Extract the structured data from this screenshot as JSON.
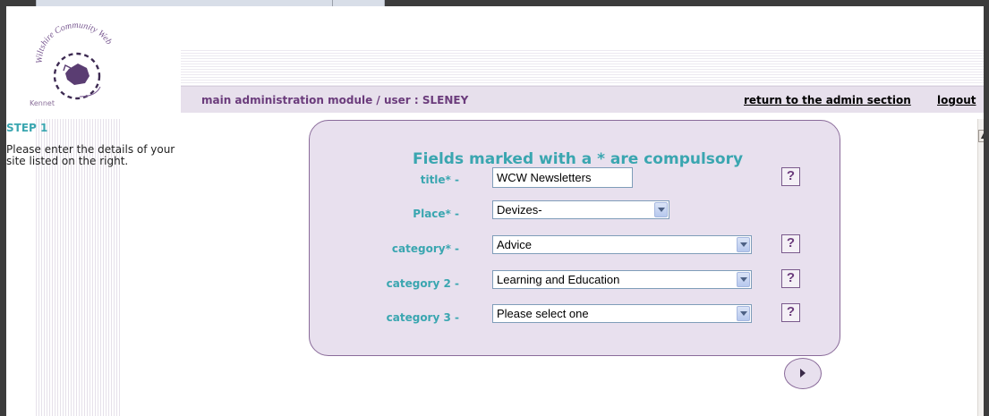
{
  "logo": {
    "community_text": "Wiltshire Community Web",
    "area_label": "Kennet"
  },
  "admin_bar": {
    "path": "main administration module / user : SLENEY",
    "return_link": "return to the admin section",
    "logout_link": "logout"
  },
  "step": {
    "title": "STEP 1",
    "instructions": "Please enter the details of your site listed on the right."
  },
  "form": {
    "heading": "Fields marked with a * are compulsory",
    "help_label": "?",
    "fields": [
      {
        "label": "title* -",
        "type": "text",
        "value": "WCW Newsletters"
      },
      {
        "label": "Place* -",
        "type": "select",
        "value": "Devizes-"
      },
      {
        "label": "category* -",
        "type": "select",
        "value": "Advice"
      },
      {
        "label": "category 2 -",
        "type": "select",
        "value": "Learning and Education"
      },
      {
        "label": "category 3 -",
        "type": "select",
        "value": "Please select one"
      }
    ]
  },
  "colors": {
    "accent_teal": "#3aa6b0",
    "accent_purple": "#6b3c7c",
    "panel_bg": "#e8e0ee"
  },
  "icons": {
    "next": "play-triangle",
    "scroll_up": "triangle-up"
  }
}
